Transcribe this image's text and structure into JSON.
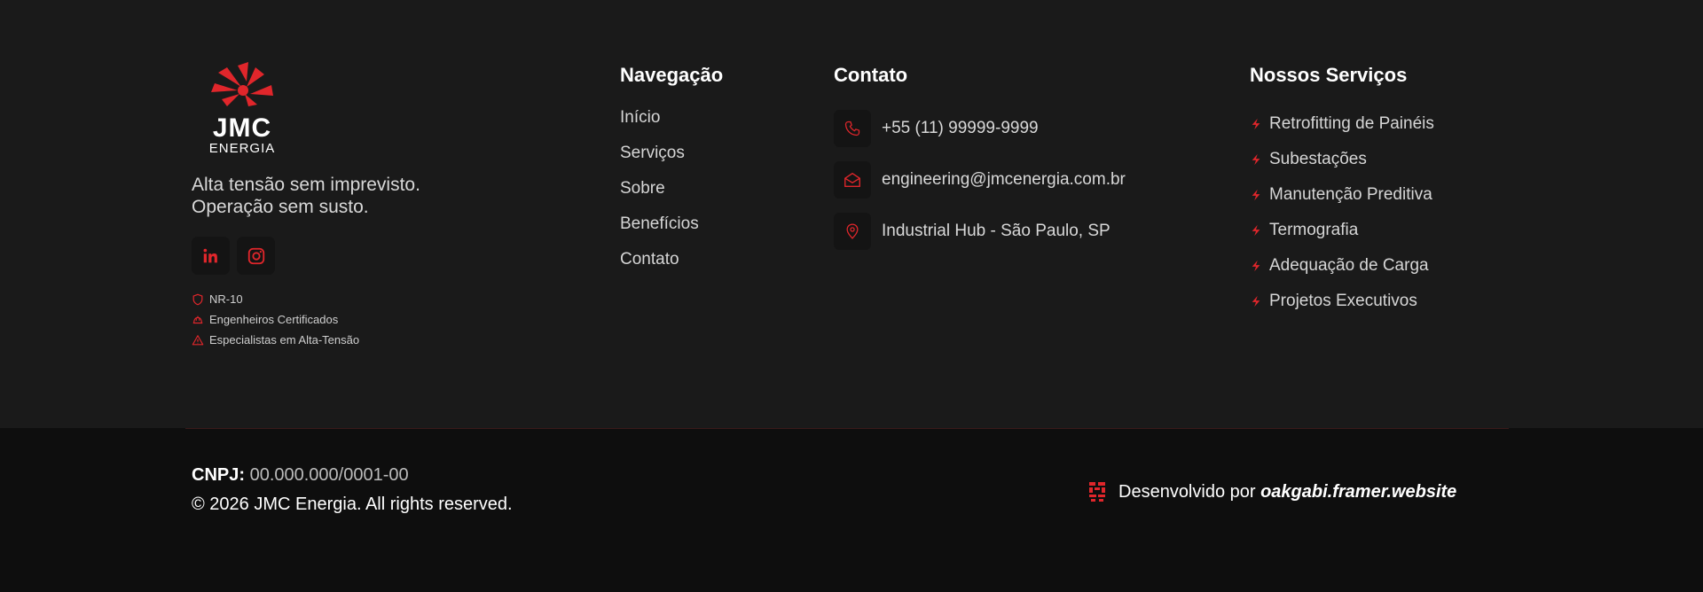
{
  "brand": {
    "logo_text": "JMC",
    "logo_subtext": "ENERGIA",
    "tagline_line1": "Alta tensão sem imprevisto.",
    "tagline_line2": "Operação sem susto.",
    "social_icons": [
      "linkedin-icon",
      "instagram-icon"
    ],
    "certs": [
      {
        "icon": "shield-icon",
        "label": "NR-10"
      },
      {
        "icon": "helmet-icon",
        "label": "Engenheiros Certificados"
      },
      {
        "icon": "warning-icon",
        "label": "Especialistas em Alta-Tensão"
      }
    ]
  },
  "navigation": {
    "title": "Navegação",
    "items": [
      "Início",
      "Serviços",
      "Sobre",
      "Benefícios",
      "Contato"
    ]
  },
  "contact": {
    "title": "Contato",
    "items": [
      {
        "icon": "phone-icon",
        "text": "+55 (11) 99999-9999"
      },
      {
        "icon": "mail-icon",
        "text": "engineering@jmcenergia.com.br"
      },
      {
        "icon": "location-pin-icon",
        "text": "Industrial Hub - São Paulo, SP"
      }
    ]
  },
  "services": {
    "title": "Nossos Serviços",
    "items": [
      "Retrofitting de Painéis",
      "Subestações",
      "Manutenção Preditiva",
      "Termografia",
      "Adequação de Carga",
      "Projetos Executivos"
    ]
  },
  "footer": {
    "cnpj_label": "CNPJ:",
    "cnpj_value": "00.000.000/0001-00",
    "copyright": "© 2026 JMC Energia. All rights reserved.",
    "credit_prefix": "Desenvolvido por",
    "credit_site": "oakgabi.framer.website"
  },
  "colors": {
    "accent": "#e0262b",
    "top_bg": "#1a1a1a",
    "bottom_bg": "#0e0e0e"
  }
}
